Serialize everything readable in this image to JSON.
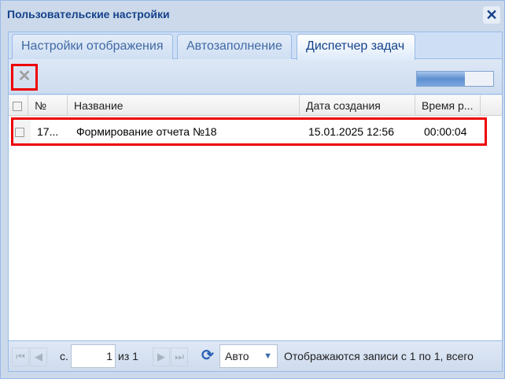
{
  "window": {
    "title": "Пользовательские настройки"
  },
  "tabs": [
    {
      "label": "Настройки отображения"
    },
    {
      "label": "Автозаполнение"
    },
    {
      "label": "Диспетчер задач"
    }
  ],
  "toolbar": {
    "progress_percent": 63
  },
  "grid": {
    "columns": [
      "№",
      "Название",
      "Дата создания",
      "Время р..."
    ],
    "rows": [
      {
        "num": "17...",
        "name": "Формирование отчета №18",
        "created": "15.01.2025 12:56",
        "time": "00:00:04"
      }
    ]
  },
  "paging": {
    "page_label": "с.",
    "page_value": "1",
    "of_label": "из 1",
    "page_size": "Авто",
    "status": "Отображаются записи с 1 по 1, всего"
  }
}
